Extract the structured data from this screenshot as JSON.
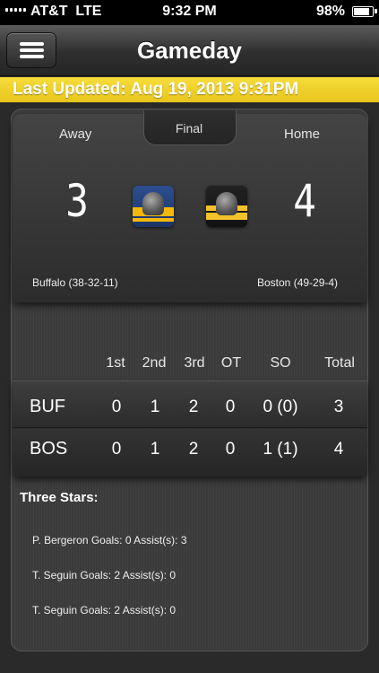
{
  "status_bar": {
    "carrier": "AT&T",
    "network": "LTE",
    "time": "9:32 PM",
    "battery": "98%",
    "battery_level": 0.98
  },
  "nav": {
    "title": "Gameday"
  },
  "updated": {
    "text": "Last Updated: Aug 19, 2013 9:31PM"
  },
  "game": {
    "away_label": "Away",
    "home_label": "Home",
    "status": "Final",
    "away_score": "3",
    "home_score": "4",
    "away_record": "Buffalo (38-32-11)",
    "home_record": "Boston (49-29-4)"
  },
  "boxscore": {
    "headers": [
      "1st",
      "2nd",
      "3rd",
      "OT",
      "SO",
      "Total"
    ],
    "rows": [
      {
        "team": "BUF",
        "values": [
          "0",
          "1",
          "2",
          "0",
          "0 (0)",
          "3"
        ]
      },
      {
        "team": "BOS",
        "values": [
          "0",
          "1",
          "2",
          "0",
          "1 (1)",
          "4"
        ]
      }
    ]
  },
  "three_stars": {
    "title": "Three Stars:",
    "items": [
      "P. Bergeron Goals: 0 Assist(s): 3",
      "T. Seguin Goals: 2 Assist(s): 0",
      "T. Seguin Goals: 2 Assist(s): 0"
    ]
  },
  "colors": {
    "accent_yellow": "#f0cf2a",
    "background": "#2a2a2a"
  }
}
